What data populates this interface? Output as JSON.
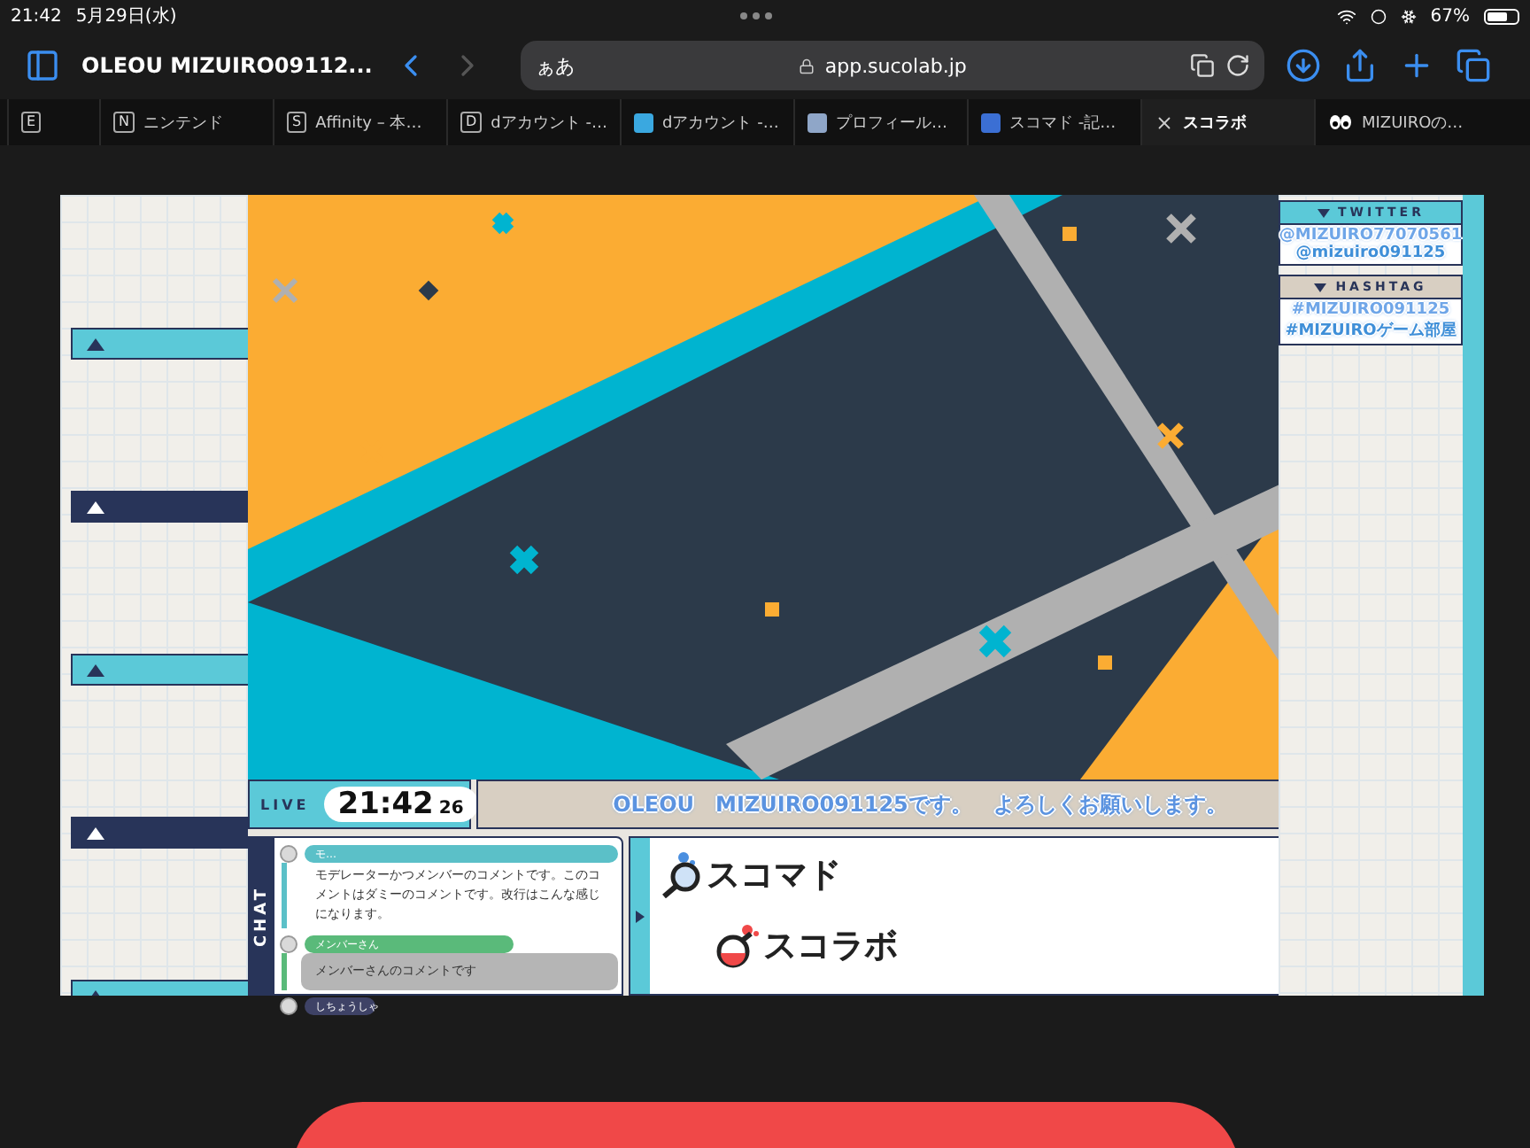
{
  "status_bar": {
    "time": "21:42",
    "date": "5月29日(水)",
    "battery": "67%"
  },
  "toolbar": {
    "page_title": "OLEOU  MIZUIRO09112...",
    "text_size": "ぁあ",
    "url": "app.sucolab.jp"
  },
  "tabs": [
    {
      "kind": "letter",
      "badge": "E",
      "selected": false
    },
    {
      "kind": "letter",
      "badge": "N",
      "label": "ニンテンド",
      "selected": false
    },
    {
      "kind": "letter",
      "badge": "S",
      "label": "Affinity – 本…",
      "selected": false
    },
    {
      "kind": "letter",
      "badge": "D",
      "label": "dアカウント -…",
      "selected": false
    },
    {
      "kind": "favicon",
      "label": "dアカウント -…",
      "selected": false
    },
    {
      "kind": "favicon",
      "label": "プロフィール…",
      "selected": false
    },
    {
      "kind": "favicon",
      "label": "スコマド -記…",
      "selected": false
    },
    {
      "kind": "close",
      "label": "スコラボ",
      "selected": true
    },
    {
      "kind": "eyes",
      "label": "MIZUIROの…",
      "selected": false
    }
  ],
  "side_bars": [
    {
      "color": "#5bc9d8"
    },
    {
      "color": "#283459"
    },
    {
      "color": "#5bc9d8"
    },
    {
      "color": "#283459"
    },
    {
      "color": "#5bc9d8"
    }
  ],
  "twitter": {
    "heading": "TWITTER",
    "accounts": [
      "@MIZUIRO77070561",
      "@mizuiro091125"
    ]
  },
  "hashtag": {
    "heading": "HASHTAG",
    "tags": [
      "#MIZUIRO091125",
      "#MIZUIROゲーム部屋"
    ]
  },
  "live": {
    "label": "LIVE",
    "time": "21:42",
    "seconds": "26"
  },
  "ticker": "OLEOU　MIZUIRO091125です。　よろしくお願いします。",
  "chat": {
    "label": "CHAT",
    "messages": [
      {
        "kind": "moderator",
        "name": "モ…",
        "text": "モデレーターかつメンバーのコメントです。このコメントはダミーのコメントです。改行はこんな感じになります。"
      },
      {
        "kind": "member",
        "name": "メンバーさん",
        "text": "メンバーさんのコメントです"
      },
      {
        "kind": "viewer",
        "name": "しちょうしゃ"
      }
    ]
  },
  "sponsors": [
    {
      "kind": "search",
      "name": "スコマド"
    },
    {
      "kind": "flask",
      "name": "スコラボ"
    }
  ]
}
